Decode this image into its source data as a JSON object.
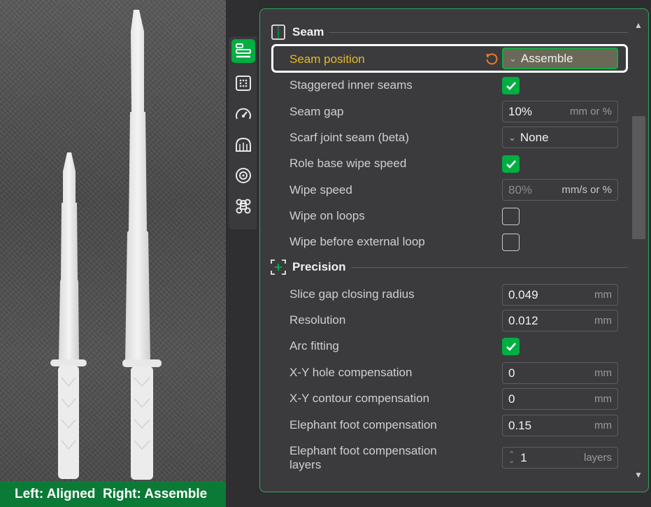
{
  "caption": {
    "left": "Left: Aligned",
    "right": "Right: Assemble"
  },
  "sidebar": {
    "tabs": [
      {
        "name": "quality-tab",
        "icon": "layers-icon",
        "active": true
      },
      {
        "name": "strength-tab",
        "icon": "infill-icon",
        "active": false
      },
      {
        "name": "speed-tab",
        "icon": "speedometer-icon",
        "active": false
      },
      {
        "name": "support-tab",
        "icon": "support-icon",
        "active": false
      },
      {
        "name": "filament-tab",
        "icon": "spool-icon",
        "active": false
      },
      {
        "name": "others-tab",
        "icon": "command-icon",
        "active": false
      }
    ]
  },
  "sections": {
    "seam": {
      "title": "Seam",
      "icon": "seam-icon"
    },
    "precision": {
      "title": "Precision",
      "icon": "precision-icon"
    }
  },
  "settings": {
    "seam_position": {
      "label": "Seam position",
      "value": "Assemble"
    },
    "staggered_inner_seams": {
      "label": "Staggered inner seams",
      "checked": true
    },
    "seam_gap": {
      "label": "Seam gap",
      "value": "10%",
      "unit": "mm or %"
    },
    "scarf_joint_seam": {
      "label": "Scarf joint seam (beta)",
      "value": "None"
    },
    "role_base_wipe_speed": {
      "label": "Role base wipe speed",
      "checked": true
    },
    "wipe_speed": {
      "label": "Wipe speed",
      "value": "80%",
      "unit": "mm/s or %"
    },
    "wipe_on_loops": {
      "label": "Wipe on loops",
      "checked": false
    },
    "wipe_before_external_loop": {
      "label": "Wipe before external loop",
      "checked": false
    },
    "slice_gap_closing_radius": {
      "label": "Slice gap closing radius",
      "value": "0.049",
      "unit": "mm"
    },
    "resolution": {
      "label": "Resolution",
      "value": "0.012",
      "unit": "mm"
    },
    "arc_fitting": {
      "label": "Arc fitting",
      "checked": true
    },
    "xy_hole_compensation": {
      "label": "X-Y hole compensation",
      "value": "0",
      "unit": "mm"
    },
    "xy_contour_compensation": {
      "label": "X-Y contour compensation",
      "value": "0",
      "unit": "mm"
    },
    "elephant_foot_compensation": {
      "label": "Elephant foot compensation",
      "value": "0.15",
      "unit": "mm"
    },
    "elephant_foot_compensation_layers": {
      "label": "Elephant foot compensation layers",
      "value": "1",
      "unit": "layers"
    }
  },
  "colors": {
    "accent": "#00ae42",
    "highlight_label": "#e6b929",
    "reset_icon": "#f07a2a",
    "caption_bg": "#0c7a37"
  }
}
